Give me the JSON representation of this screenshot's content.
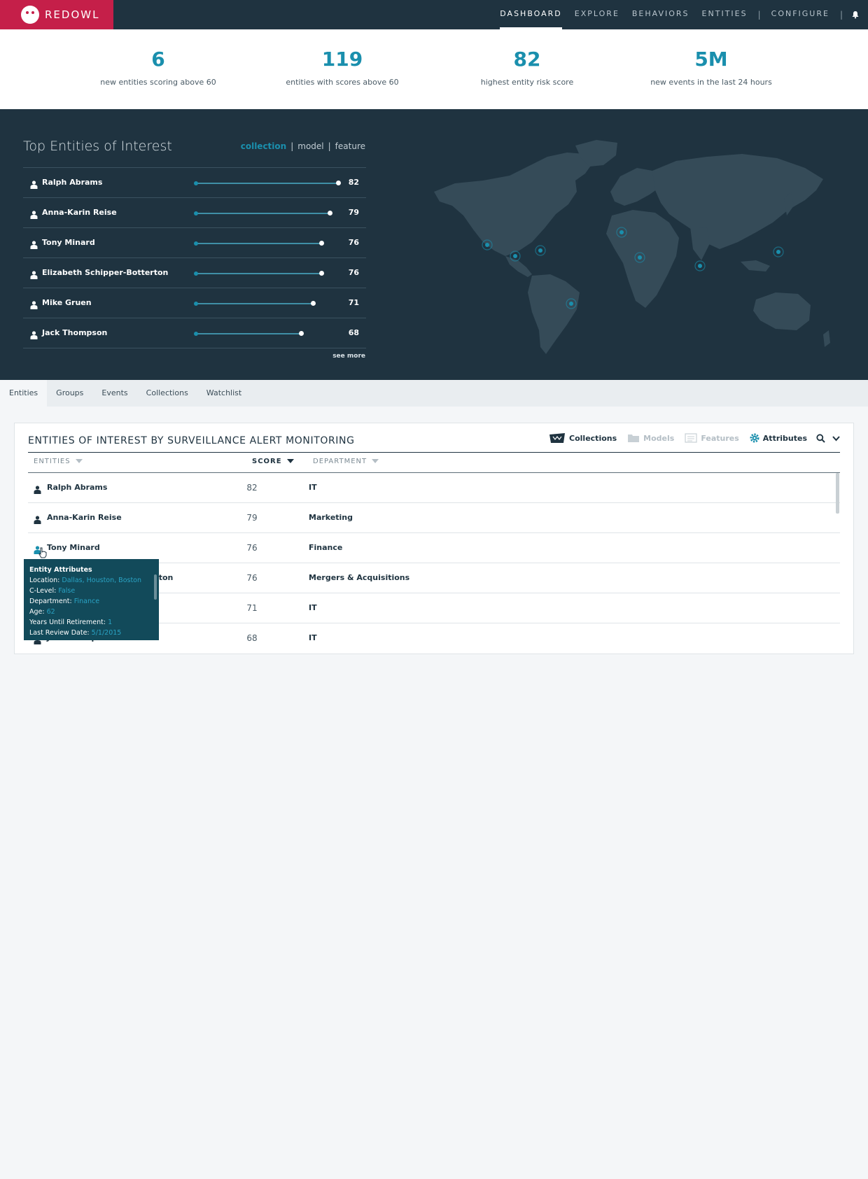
{
  "brand": {
    "name": "REDOWL"
  },
  "nav": {
    "items": [
      {
        "label": "DASHBOARD",
        "active": true
      },
      {
        "label": "EXPLORE",
        "active": false
      },
      {
        "label": "BEHAVIORS",
        "active": false
      },
      {
        "label": "ENTITIES",
        "active": false
      }
    ],
    "separator": "|",
    "configure": "CONFIGURE",
    "bell_icon": "bell-icon"
  },
  "stats": [
    {
      "value": "6",
      "label": "new entities scoring above 60"
    },
    {
      "value": "119",
      "label": "entities with scores above 60"
    },
    {
      "value": "82",
      "label": "highest entity risk score"
    },
    {
      "value": "5M",
      "label": "new events in the last 24 hours"
    }
  ],
  "top": {
    "title": "Top Entities of Interest",
    "toggle": {
      "collection": "collection",
      "model": "model",
      "feature": "feature",
      "sep": "|"
    },
    "rows": [
      {
        "name": "Ralph Abrams",
        "score": "82",
        "level": 1.0
      },
      {
        "name": "Anna-Karin Reise",
        "score": "79",
        "level": 0.94
      },
      {
        "name": "Tony Minard",
        "score": "76",
        "level": 0.88
      },
      {
        "name": "Elizabeth Schipper-Botterton",
        "score": "76",
        "level": 0.88
      },
      {
        "name": "Mike Gruen",
        "score": "71",
        "level": 0.82
      },
      {
        "name": "Jack Thompson",
        "score": "68",
        "level": 0.74
      }
    ],
    "see_more": "see more"
  },
  "tabs": [
    {
      "label": "Entities",
      "active": true
    },
    {
      "label": "Groups",
      "active": false
    },
    {
      "label": "Events",
      "active": false
    },
    {
      "label": "Collections",
      "active": false
    },
    {
      "label": "Watchlist",
      "active": false
    }
  ],
  "table": {
    "title": "ENTITIES OF INTEREST BY SURVEILLANCE ALERT MONITORING",
    "tools": {
      "collections": "Collections",
      "models": "Models",
      "features": "Features",
      "attributes": "Attributes"
    },
    "headers": {
      "entities": "ENTITIES",
      "score": "SCORE",
      "department": "DEPARTMENT"
    },
    "rows": [
      {
        "name": "Ralph Abrams",
        "score": "82",
        "department": "IT"
      },
      {
        "name": "Anna-Karin Reise",
        "score": "79",
        "department": "Marketing"
      },
      {
        "name": "Tony Minard",
        "score": "76",
        "department": "Finance"
      },
      {
        "name": "Elizabeth Schipper-Botterton",
        "score": "76",
        "department": "Mergers & Acquisitions"
      },
      {
        "name": "Mike Gruen",
        "score": "71",
        "department": "IT"
      },
      {
        "name": "Jack Thompson",
        "score": "68",
        "department": "IT"
      }
    ]
  },
  "tooltip": {
    "title": "Entity Attributes",
    "lines": [
      {
        "k": "Location:",
        "v": "Dallas, Houston, Boston"
      },
      {
        "k": "C-Level:",
        "v": "False"
      },
      {
        "k": "Department:",
        "v": "Finance"
      },
      {
        "k": "Age:",
        "v": "62"
      },
      {
        "k": "Years Until Retirement:",
        "v": "1"
      },
      {
        "k": "Last Review Date:",
        "v": "5/1/2015"
      }
    ]
  },
  "colors": {
    "brand": "#c51f49",
    "navy": "#1f3340",
    "accent": "#1a8fad"
  }
}
